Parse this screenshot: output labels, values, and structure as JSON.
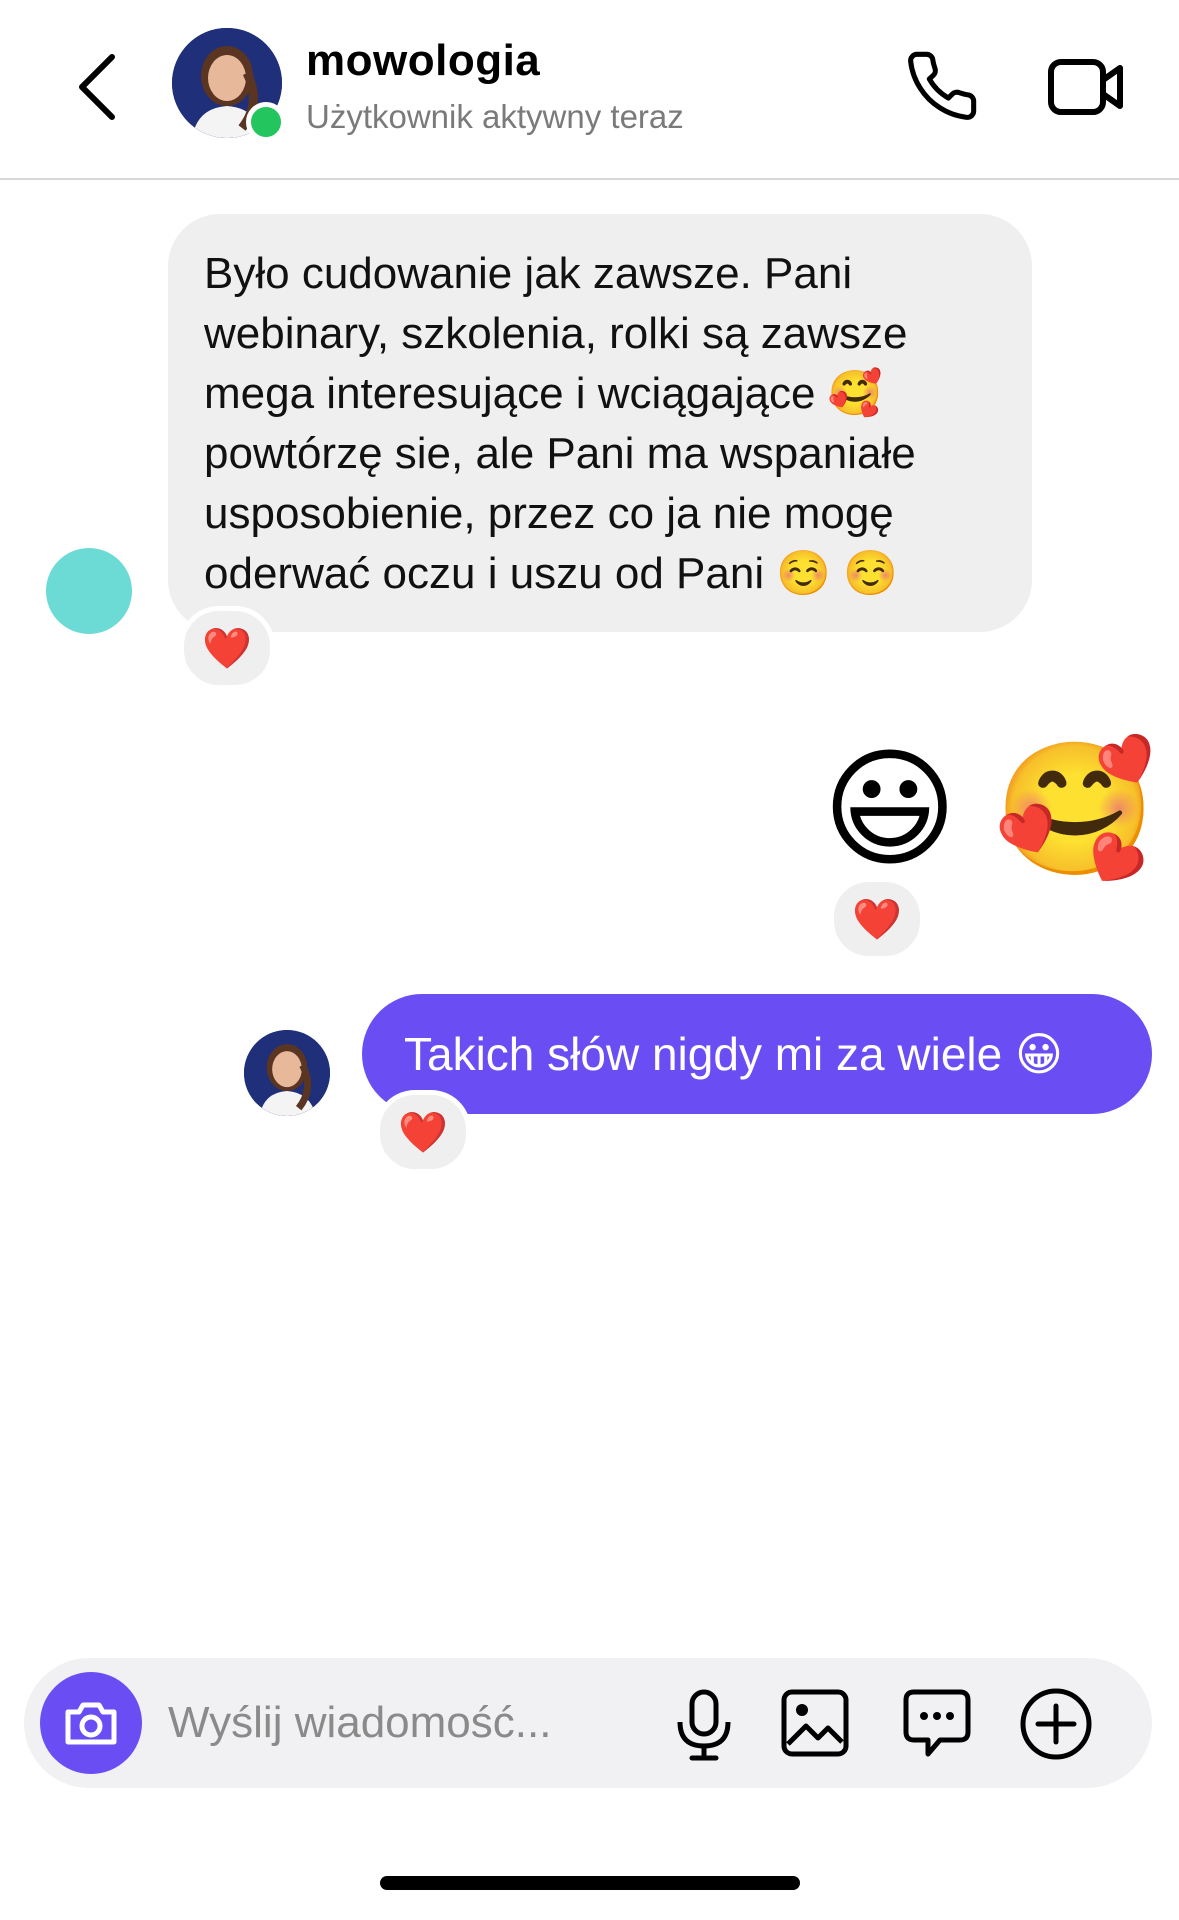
{
  "header": {
    "contact_name": "mowologia",
    "status": "Użytkownik aktywny teraz"
  },
  "messages": [
    {
      "direction": "incoming",
      "text": "Było cudowanie jak zawsze. Pani webinary, szkolenia, rolki są zawsze mega interesujące i wciągające 🥰 powtórzę sie, ale Pani ma wspaniałe usposobienie, przez co ja nie mogę oderwać oczu i uszu od Pani ☺️ ☺️",
      "reaction": "❤️"
    },
    {
      "direction": "outgoing",
      "emojis": [
        "😃",
        "🥰"
      ],
      "reaction": "❤️"
    },
    {
      "direction": "outgoing",
      "text": "Takich słów nigdy mi za wiele 😀",
      "reaction": "❤️"
    }
  ],
  "composer": {
    "placeholder": "Wyślij wiadomość..."
  },
  "icons": {
    "back": "chevron-left-icon",
    "call": "phone-icon",
    "video": "video-camera-icon",
    "camera": "camera-icon",
    "mic": "microphone-icon",
    "gallery": "image-icon",
    "sticker": "chat-bubble-icon",
    "plus": "plus-circle-icon"
  },
  "colors": {
    "accent": "#6a4ef4",
    "online": "#22c55e",
    "incoming_bubble": "#efefef",
    "sender_avatar": "#6cdbd5"
  }
}
